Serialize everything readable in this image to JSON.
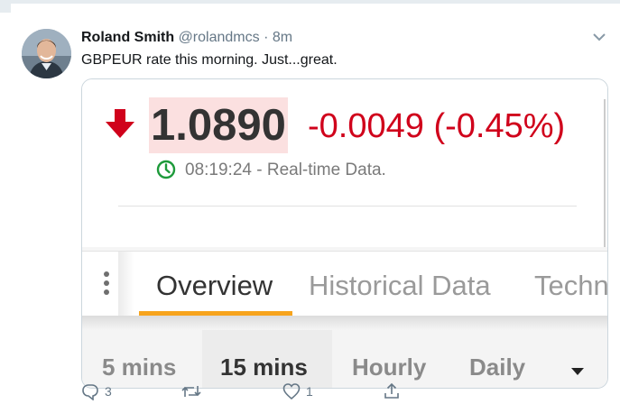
{
  "tweet": {
    "author_name": "Roland Smith",
    "author_handle": "@rolandmcs",
    "separator": "·",
    "time": "8m",
    "text": "GBPEUR rate this morning. Just...great."
  },
  "quote": {
    "price": "1.0890",
    "change": "-0.0049 (-0.45%)",
    "realtime_label": "08:19:24 - Real-time Data.",
    "direction_icon": "down-arrow-icon",
    "colors": {
      "negative": "#d0011b",
      "price_highlight": "#fbe0e0",
      "clock": "#1d9a3a",
      "tab_accent": "#f7a41d"
    }
  },
  "tabs": [
    {
      "label": "Overview",
      "active": true
    },
    {
      "label": "Historical Data",
      "active": false
    },
    {
      "label": "Techn",
      "active": false
    }
  ],
  "ranges": [
    {
      "label": "5 mins",
      "active": false
    },
    {
      "label": "15 mins",
      "active": true
    },
    {
      "label": "Hourly",
      "active": false
    },
    {
      "label": "Daily",
      "active": false
    }
  ],
  "actions": {
    "reply_count": "3",
    "retweet_count": "",
    "like_count": "1"
  }
}
